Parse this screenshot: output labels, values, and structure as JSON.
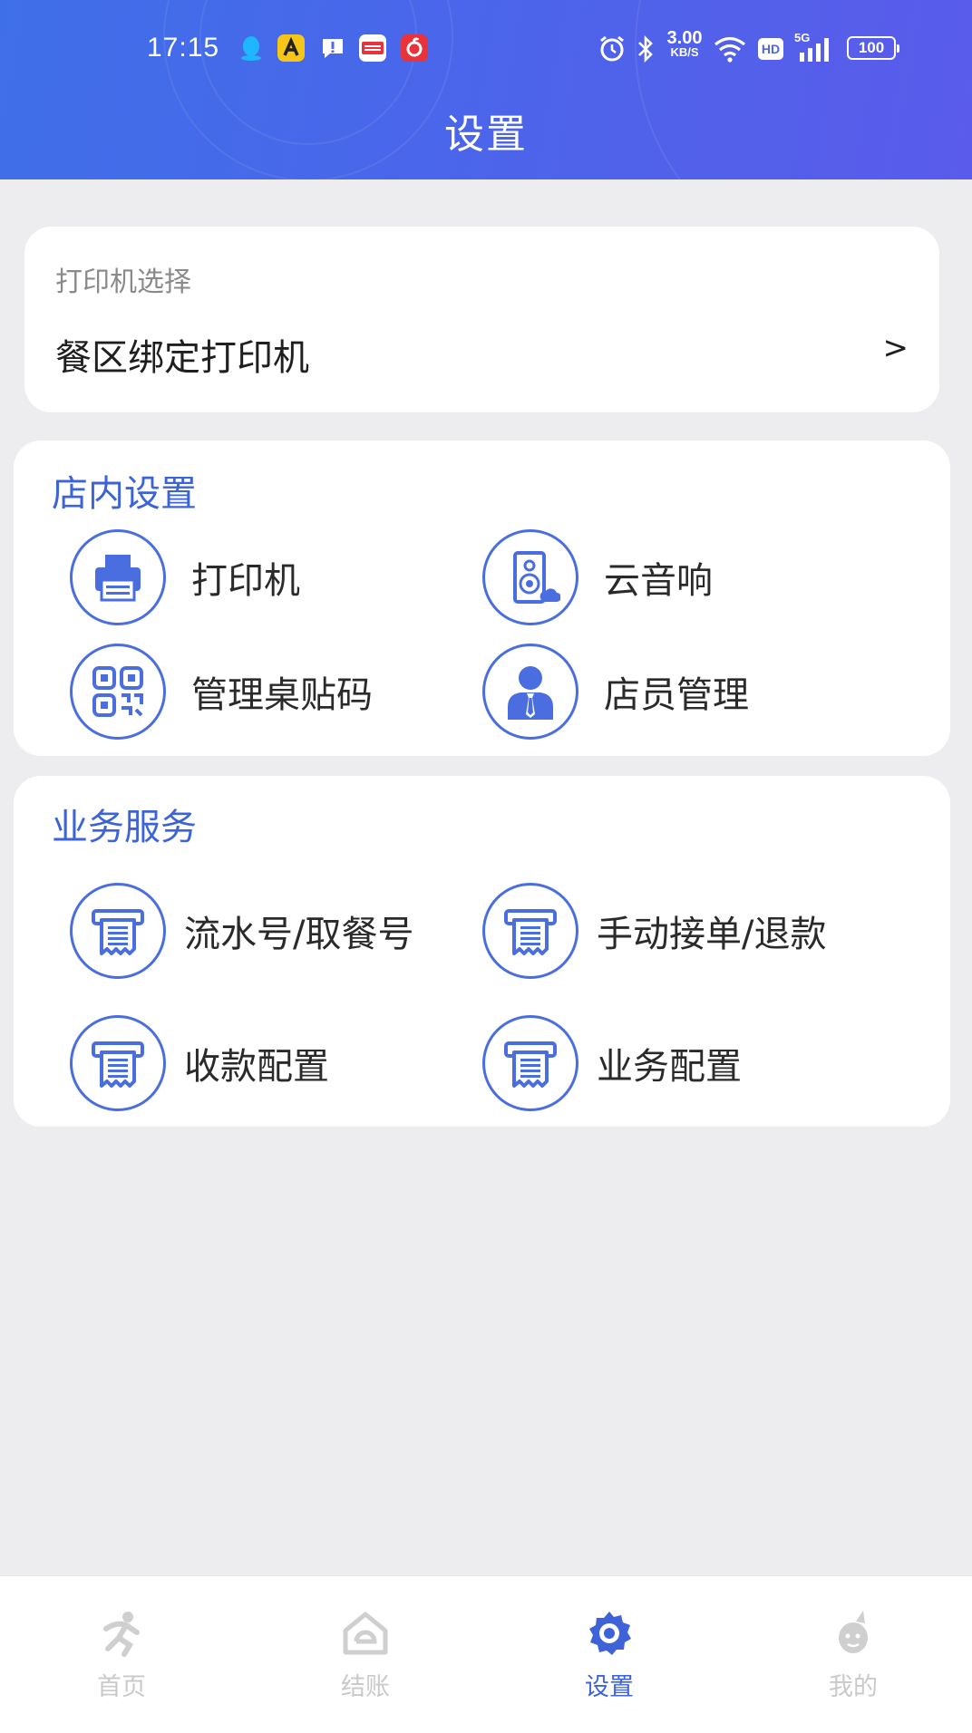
{
  "status_bar": {
    "time": "17:15",
    "speed_value": "3.00",
    "speed_unit": "KB/S",
    "hd": "HD",
    "network": "5G",
    "battery": "100"
  },
  "header": {
    "title": "设置"
  },
  "printer_card": {
    "hint": "打印机选择",
    "row_label": "餐区绑定打印机",
    "arrow": ">"
  },
  "store_settings": {
    "title": "店内设置",
    "items": [
      {
        "label": "打印机",
        "icon": "printer-icon"
      },
      {
        "label": "云音响",
        "icon": "speaker-icon"
      },
      {
        "label": "管理桌贴码",
        "icon": "qr-code-icon"
      },
      {
        "label": "店员管理",
        "icon": "staff-icon"
      }
    ]
  },
  "business_services": {
    "title": "业务服务",
    "items": [
      {
        "label": "流水号/取餐号",
        "icon": "receipt-icon"
      },
      {
        "label": "手动接单/退款",
        "icon": "receipt-icon"
      },
      {
        "label": "收款配置",
        "icon": "receipt-icon"
      },
      {
        "label": "业务配置",
        "icon": "receipt-icon"
      }
    ]
  },
  "bottom_nav": {
    "items": [
      {
        "label": "首页",
        "icon": "home-runner-icon",
        "active": false
      },
      {
        "label": "结账",
        "icon": "checkout-house-icon",
        "active": false
      },
      {
        "label": "设置",
        "icon": "gear-icon",
        "active": true
      },
      {
        "label": "我的",
        "icon": "profile-mascot-icon",
        "active": false
      }
    ]
  },
  "colors": {
    "accent": "#3e63d9",
    "header_start": "#3f6fe8",
    "header_end": "#5a5bea",
    "background": "#ededef",
    "inactive": "#c9c9c9"
  }
}
